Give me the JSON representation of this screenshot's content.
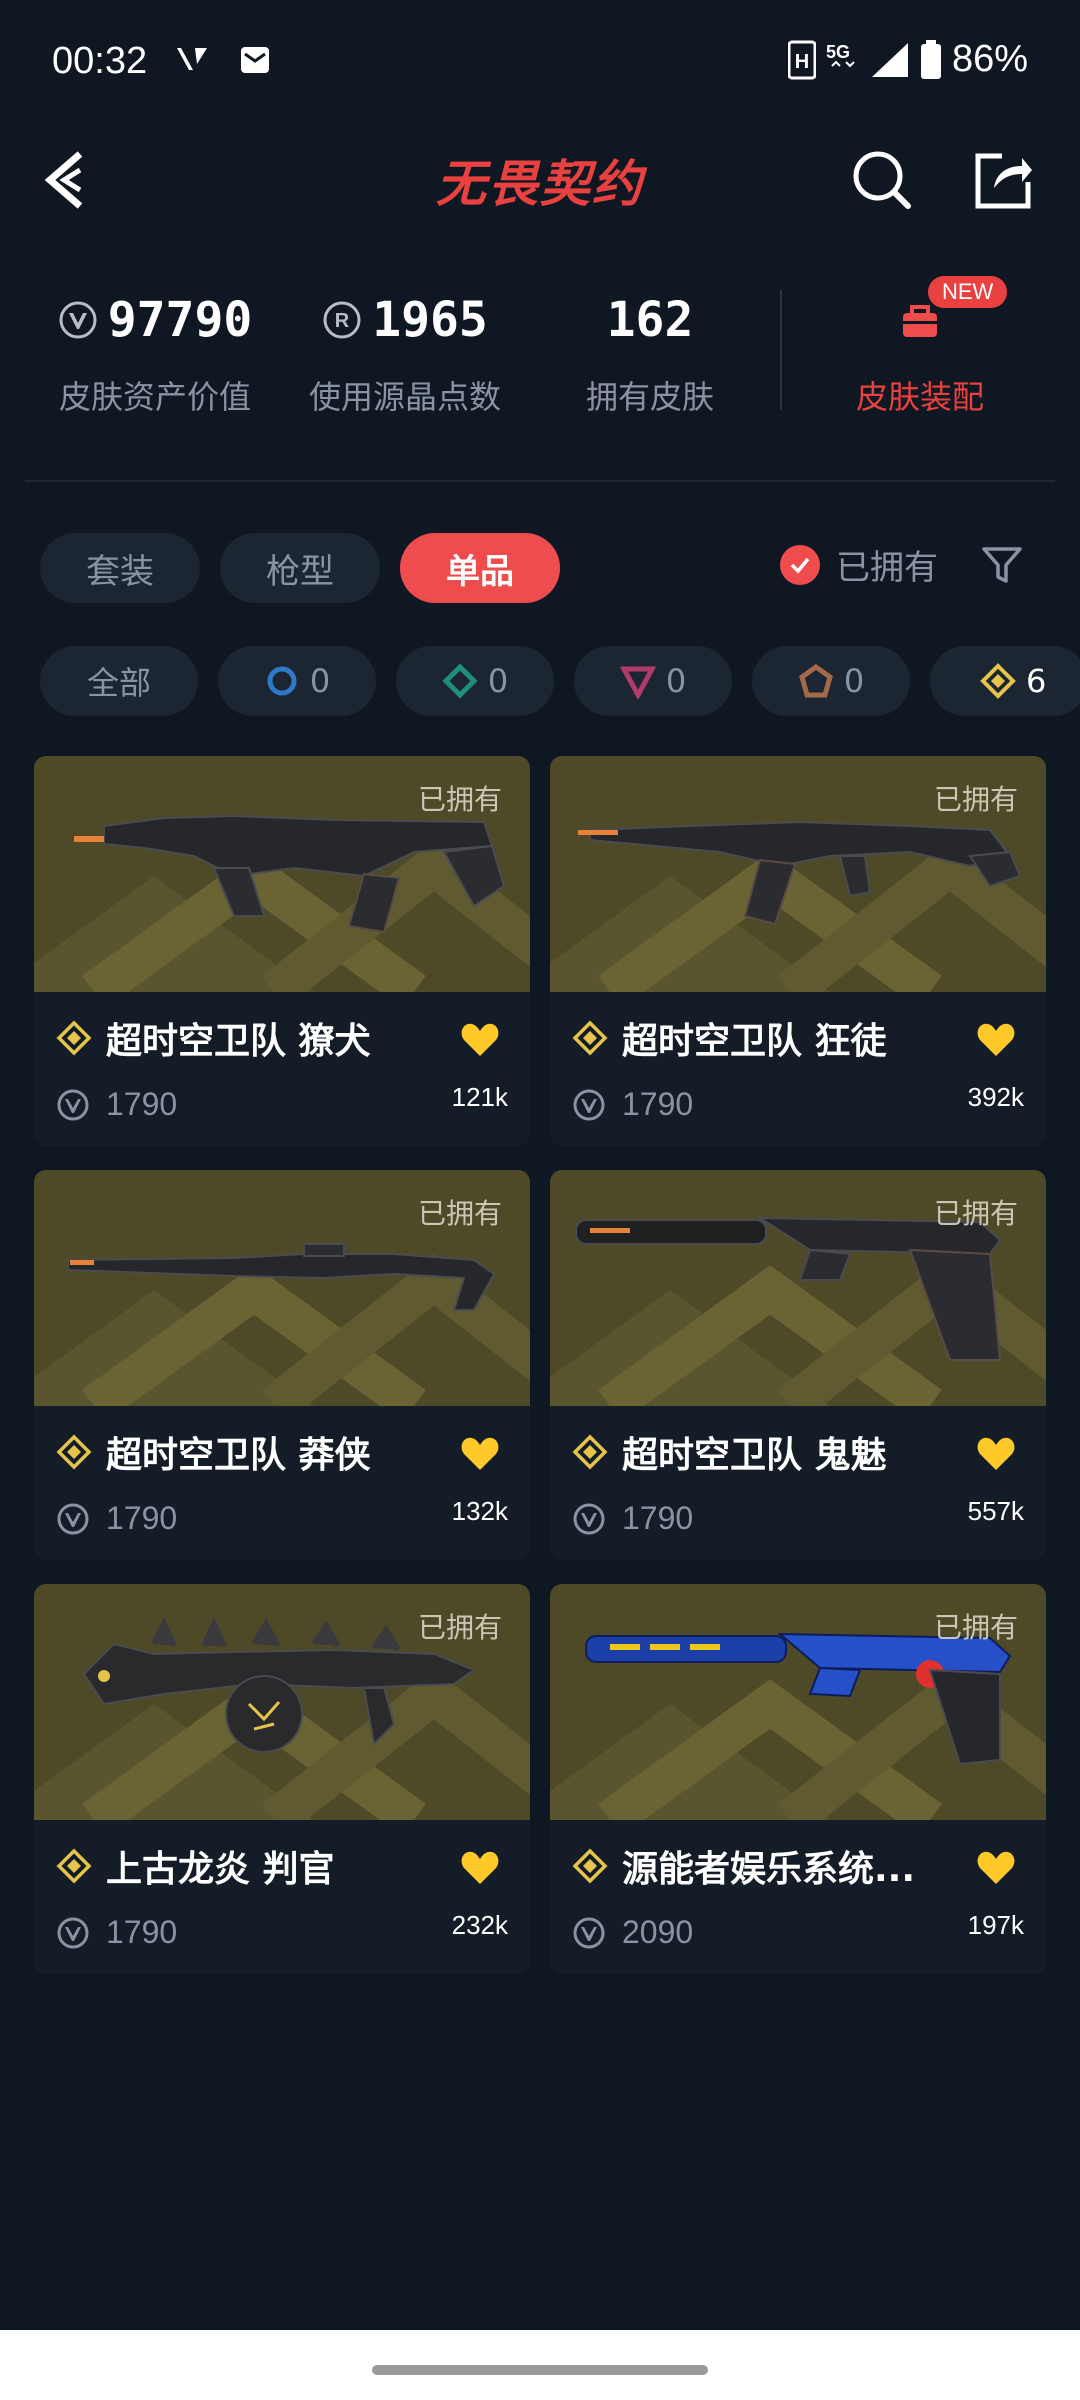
{
  "status_bar": {
    "time": "00:32",
    "battery": "86%",
    "network": "5G"
  },
  "header": {
    "title": "无畏契约"
  },
  "stats": {
    "asset_value": "97790",
    "asset_value_label": "皮肤资产价值",
    "radianite_points": "1965",
    "radianite_label": "使用源晶点数",
    "owned_skins": "162",
    "owned_skins_label": "拥有皮肤",
    "outfit_label": "皮肤装配",
    "new_badge": "NEW"
  },
  "tabs": [
    {
      "label": "套装",
      "active": false
    },
    {
      "label": "枪型",
      "active": false
    },
    {
      "label": "单品",
      "active": true
    }
  ],
  "owned_filter": {
    "label": "已拥有",
    "checked": true
  },
  "rarity_chips": [
    {
      "label": "全部",
      "icon": "all"
    },
    {
      "count": "0",
      "icon": "select-tier-icon",
      "color": "#2f79c9"
    },
    {
      "count": "0",
      "icon": "deluxe-tier-icon",
      "color": "#1d8f7a"
    },
    {
      "count": "0",
      "icon": "premium-tier-icon",
      "color": "#b13a6b"
    },
    {
      "count": "0",
      "icon": "exclusive-tier-icon",
      "color": "#a36a4a"
    },
    {
      "count": "6",
      "icon": "ultra-tier-icon",
      "color": "#e6c44a"
    }
  ],
  "skins": [
    {
      "name": "超时空卫队 獠犬",
      "price": "1790",
      "likes": "121k",
      "owned_label": "已拥有",
      "weapon": "smg"
    },
    {
      "name": "超时空卫队 狂徒",
      "price": "1790",
      "likes": "392k",
      "owned_label": "已拥有",
      "weapon": "rifle"
    },
    {
      "name": "超时空卫队 莽侠",
      "price": "1790",
      "likes": "132k",
      "owned_label": "已拥有",
      "weapon": "sniper"
    },
    {
      "name": "超时空卫队 鬼魅",
      "price": "1790",
      "likes": "557k",
      "owned_label": "已拥有",
      "weapon": "pistol"
    },
    {
      "name": "上古龙炎 判官",
      "price": "1790",
      "likes": "232k",
      "owned_label": "已拥有",
      "weapon": "dragon"
    },
    {
      "name": "源能者娱乐系统...",
      "price": "2090",
      "likes": "197k",
      "owned_label": "已拥有",
      "weapon": "blue-pistol"
    }
  ],
  "colors": {
    "accent": "#ef4d4d",
    "background": "#0f1723",
    "card": "#141c28",
    "gold": "#e6c44a"
  }
}
